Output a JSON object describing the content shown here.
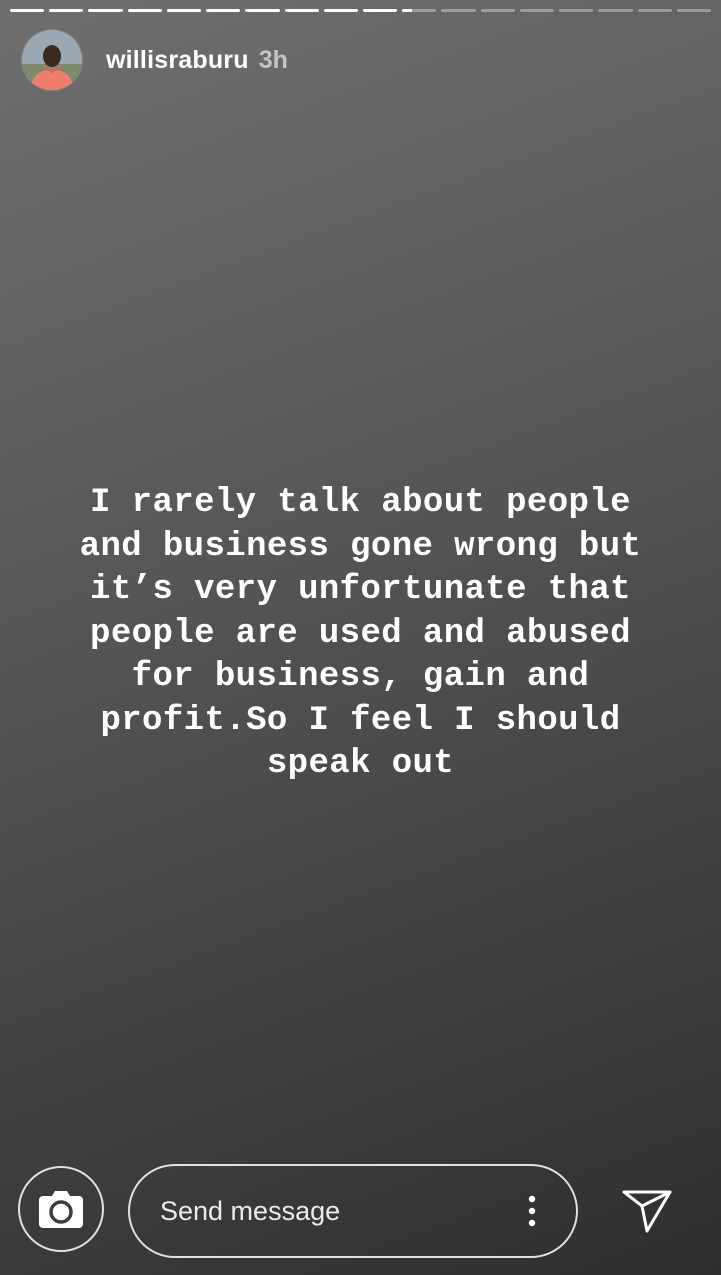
{
  "story": {
    "username": "willisraburu",
    "time": "3h",
    "text": "I rarely talk about people\nand business gone wrong but\nit’s very unfortunate that\npeople are used and abused\nfor business, gain and\nprofit.So I feel I should\nspeak out",
    "progress": {
      "total_segments": 18,
      "completed_segments": 10,
      "current_segment_fill": 0.3
    }
  },
  "icons": {
    "camera": "camera-icon",
    "more": "more-vertical-icon",
    "send": "send-icon",
    "avatar": "avatar"
  },
  "reply": {
    "placeholder": "Send message"
  },
  "colors": {
    "background_top": "#6f6f6f",
    "background_bottom": "#2e2e2e",
    "text": "#ffffff"
  }
}
